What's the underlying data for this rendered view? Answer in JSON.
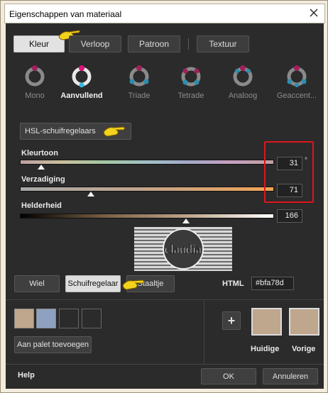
{
  "window": {
    "title": "Eigenschappen van materiaal"
  },
  "tabs": [
    {
      "label": "Kleur",
      "active": true
    },
    {
      "label": "Verloop"
    },
    {
      "label": "Patroon"
    },
    {
      "label": "Textuur"
    }
  ],
  "harmonies": [
    "Mono",
    "Aanvullend",
    "Triade",
    "Tetrade",
    "Analoog",
    "Geaccent..."
  ],
  "mode_dropdown": {
    "value": "HSL-schuifregelaars"
  },
  "sliders": {
    "hue": {
      "label": "Kleurtoon",
      "value": "31",
      "unit": "°",
      "fraction": 0.085
    },
    "saturation": {
      "label": "Verzadiging",
      "value": "71",
      "fraction": 0.28
    },
    "lightness": {
      "label": "Helderheid",
      "value": "166",
      "fraction": 0.65
    }
  },
  "logo": {
    "text": "claudia"
  },
  "view_buttons": {
    "wheel": "Wiel",
    "sliders": "Schuifregelaar",
    "swatch": "Staaltje"
  },
  "html_field": {
    "label": "HTML",
    "value": "#bfa78d"
  },
  "palette": {
    "add_button": "Aan palet toevoegen",
    "plus": "+",
    "current_label": "Huidige",
    "previous_label": "Vorige"
  },
  "colors": {
    "current": "#bfa78d",
    "previous": "#bfa78d",
    "palette_swatch_1": "#bfa78d",
    "palette_swatch_2": "#8ea1c0",
    "highlight": "#e0141b"
  },
  "footer": {
    "help": "Help",
    "ok": "OK",
    "cancel": "Annuleren"
  }
}
